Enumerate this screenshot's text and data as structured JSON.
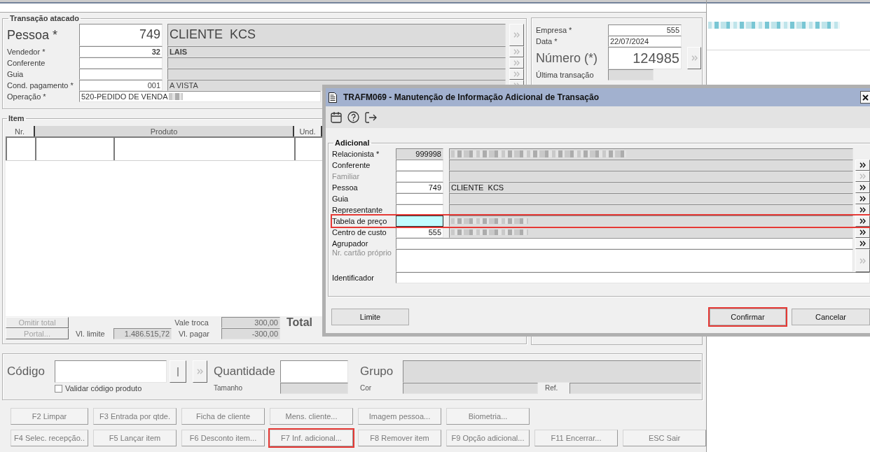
{
  "transaction": {
    "title": "Transação atacado",
    "rows": [
      {
        "kind": "large",
        "label": "Pessoa *",
        "code": "749",
        "description": "CLIENTE  KCS",
        "button_disabled": true
      },
      {
        "kind": "bold",
        "label": "Vendedor *",
        "code": "32",
        "description": "LAIS",
        "button_disabled": true
      },
      {
        "kind": "plain",
        "label": "Conferente",
        "button_disabled": true
      },
      {
        "kind": "plain",
        "label": "Guia",
        "button_disabled": true
      },
      {
        "kind": "plain",
        "label": "Cond. pagamento *",
        "code": "001",
        "description": "A VISTA",
        "button_disabled": true
      },
      {
        "kind": "text",
        "label": "Operação *",
        "value": "520-PEDIDO DE VENDA",
        "redacted": true
      }
    ]
  },
  "company": {
    "rows": [
      {
        "kind": "number",
        "label": "Empresa *",
        "value": "555"
      },
      {
        "kind": "date",
        "label": "Data *",
        "value": "22/07/2024"
      },
      {
        "kind": "large",
        "label": "Número (*)",
        "value": "124985",
        "button_disabled": true
      },
      {
        "kind": "readonly",
        "label": "Última transação"
      }
    ]
  },
  "items": {
    "title": "Item",
    "columns": [
      {
        "label": "Nr.",
        "selected": false
      },
      {
        "label": "Produto",
        "selected": true
      },
      {
        "label": "Und.",
        "selected": false
      }
    ],
    "buttons": [
      {
        "label": "Omitir total",
        "disabled": true
      },
      {
        "label": "Portal...",
        "disabled": true
      }
    ],
    "limit_label": "Vl. limite",
    "limit_value": "1.486.515,72",
    "exchange_label": "Vale troca",
    "exchange_value": "300,00",
    "pay_label": "Vl. pagar",
    "pay_value": "-300,00",
    "total_label": "Total"
  },
  "product_entry": {
    "code_label": "Código",
    "validate": {
      "label": "Validar código produto",
      "checked": false
    },
    "quantity_label": "Quantidade",
    "size_label": "Tamanho",
    "group_label": "Grupo",
    "color_label": "Cor",
    "ref_label": "Ref."
  },
  "button_rows": [
    {
      "buttons": [
        {
          "label": "F2 Limpar",
          "highlighted": false
        },
        {
          "label": "F3 Entrada por qtde.",
          "highlighted": false
        },
        {
          "label": "Ficha de cliente",
          "highlighted": false
        },
        {
          "label": "Mens. cliente...",
          "highlighted": false
        },
        {
          "label": "Imagem pessoa...",
          "highlighted": false
        },
        {
          "label": "Biometria...",
          "highlighted": false
        }
      ]
    },
    {
      "buttons": [
        {
          "label": "F4 Selec. recepção..",
          "highlighted": false
        },
        {
          "label": "F5 Lançar item",
          "highlighted": false
        },
        {
          "label": "F6 Desconto item...",
          "highlighted": false
        },
        {
          "label": "F7 Inf. adicional...",
          "highlighted": true
        },
        {
          "label": "F8 Remover item",
          "highlighted": false
        },
        {
          "label": "F9 Opção adicional...",
          "highlighted": false
        },
        {
          "label": "F11 Encerrar...",
          "highlighted": false
        },
        {
          "label": "ESC Sair",
          "highlighted": false
        }
      ]
    }
  ],
  "dialog": {
    "title": "TRAFM069 - Manutenção de Informação Adicional de Transação",
    "group_title": "Adicional",
    "rows": [
      {
        "kind": "readonly",
        "label": "Relacionista *",
        "code": "999998",
        "redacted": true,
        "disabled": false,
        "focused": false,
        "highlighted": false
      },
      {
        "kind": "lookup",
        "label": "Conferente",
        "redacted": false,
        "disabled": false,
        "focused": false,
        "highlighted": false
      },
      {
        "kind": "lookup",
        "label": "Familiar",
        "redacted": false,
        "disabled": true,
        "focused": false,
        "highlighted": false
      },
      {
        "kind": "lookup",
        "label": "Pessoa",
        "code": "749",
        "description": "CLIENTE  KCS",
        "redacted": false,
        "disabled": false,
        "focused": false,
        "highlighted": false
      },
      {
        "kind": "lookup",
        "label": "Guia",
        "redacted": false,
        "disabled": false,
        "focused": false,
        "highlighted": false
      },
      {
        "kind": "lookup",
        "label": "Representante",
        "redacted": false,
        "disabled": false,
        "focused": false,
        "highlighted": false
      },
      {
        "kind": "lookup",
        "label": "Tabela de preço",
        "redacted": true,
        "disabled": false,
        "focused": true,
        "highlighted": true
      },
      {
        "kind": "lookup",
        "label": "Centro de custo",
        "code": "555",
        "redacted": true,
        "disabled": false,
        "focused": false,
        "highlighted": false
      },
      {
        "kind": "text",
        "label": "Agrupador",
        "disabled": false,
        "focused": false,
        "highlighted": false
      },
      {
        "kind": "memo",
        "label": "Nr. cartão próprio",
        "disabled": true,
        "focused": false,
        "highlighted": false
      },
      {
        "kind": "plain",
        "label": "Identificador",
        "disabled": false,
        "focused": false,
        "highlighted": false
      }
    ],
    "buttons": [
      {
        "label": "Limite",
        "highlighted": false
      },
      {
        "label": "Confirmar",
        "highlighted": true
      },
      {
        "label": "Cancelar",
        "highlighted": false
      }
    ]
  }
}
